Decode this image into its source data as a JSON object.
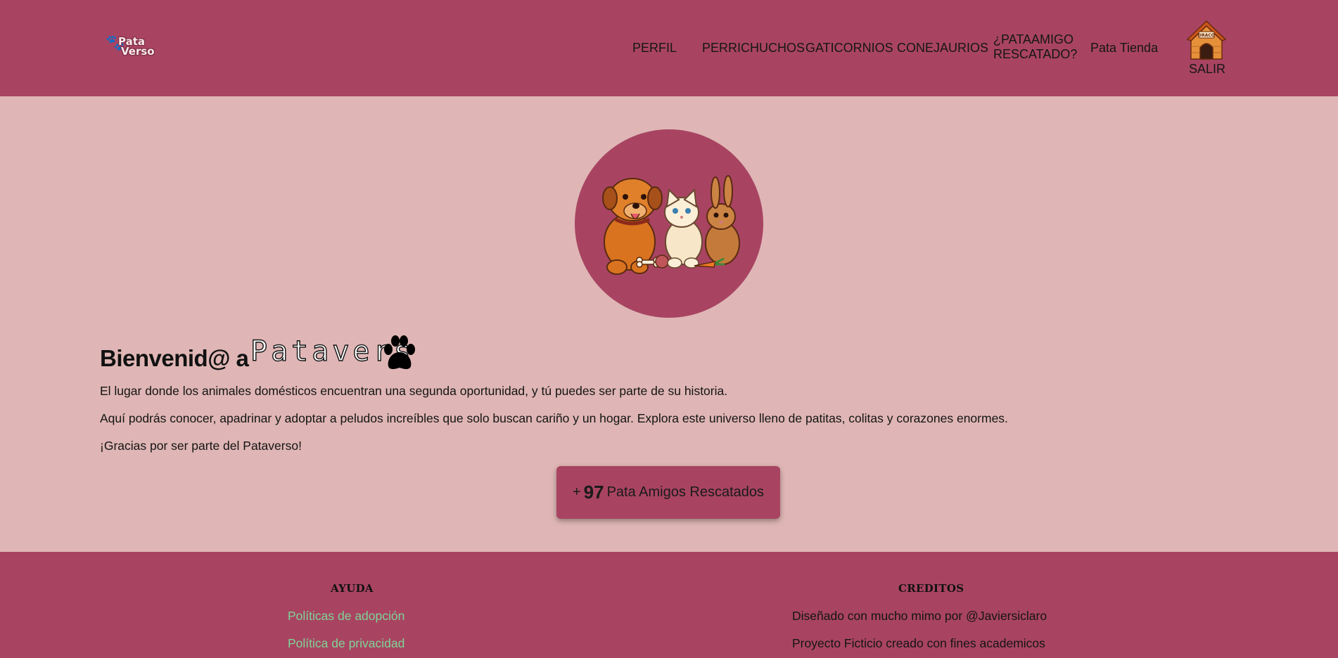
{
  "header": {
    "logo": {
      "line1": "Pata",
      "line2": "Verso",
      "icon": "paw-icon"
    },
    "nav": [
      {
        "label": "PERFIL"
      },
      {
        "label": "PERRICHUCHOS"
      },
      {
        "label": "GATICORNIOS"
      },
      {
        "label": "CONEJAURIOS"
      },
      {
        "label": "¿PATAAMIGO RESCATADO?"
      },
      {
        "label": "Pata Tienda"
      }
    ],
    "logout": {
      "house_sign": "DRACO",
      "label": "SALIR",
      "icon": "dog-house-icon"
    }
  },
  "hero": {
    "image": "dog-cat-rabbit-illustration",
    "welcome_prefix": "Bienvenid@ a",
    "brand_word": "Patavers",
    "brand_icon": "paw-icon",
    "paragraphs": [
      "El lugar donde los animales domésticos encuentran una segunda oportunidad, y tú puedes ser parte de su historia.",
      "Aquí podrás conocer, apadrinar y adoptar a peludos increíbles que solo buscan cariño y un hogar. Explora este universo lleno de patitas, colitas y corazones enormes.",
      "¡Gracias por ser parte del Pataverso!"
    ],
    "counter": {
      "prefix": "+",
      "number": "97",
      "suffix": "Pata Amigos Rescatados"
    }
  },
  "footer": {
    "help": {
      "heading": "AYUDA",
      "links": [
        "Políticas de adopción",
        "Política de privacidad"
      ]
    },
    "credits": {
      "heading": "CREDITOS",
      "lines": [
        "Diseñado con mucho mimo por @Javiersiclaro",
        "Proyecto Ficticio creado con fines academicos"
      ]
    }
  },
  "colors": {
    "primary": "#a84462",
    "background": "#dfb6b5",
    "footer_link": "#7fd497",
    "text": "#111111"
  }
}
